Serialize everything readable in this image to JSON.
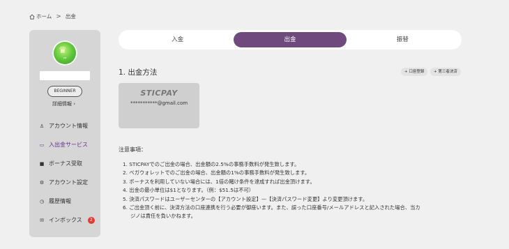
{
  "breadcrumb": {
    "home_label": "ホーム",
    "separator": ">",
    "current": "出金"
  },
  "sidebar": {
    "avatar_text": "VIP",
    "rank": "BEGINNER",
    "details_link": "詳細情報 ›",
    "items": [
      {
        "label": "アカウント情報",
        "icon": "person-icon"
      },
      {
        "label": "入出金サービス",
        "icon": "wallet-icon",
        "active": true
      },
      {
        "label": "ボーナス受取",
        "icon": "gift-icon"
      },
      {
        "label": "アカウント設定",
        "icon": "gear-icon"
      },
      {
        "label": "履歴情報",
        "icon": "history-icon"
      },
      {
        "label": "インボックス",
        "icon": "mail-icon",
        "badge": "2"
      }
    ]
  },
  "tabs": [
    "入金",
    "出金",
    "振替"
  ],
  "active_tab": 1,
  "section": {
    "title": "1. 出金方法",
    "add_account_button": "+ 口座登録",
    "third_party_button": "+ 第三者決済"
  },
  "method_card": {
    "name": "STICPAY",
    "email": "***********@gmail.com"
  },
  "notes": {
    "title": "注意事項：",
    "lines": [
      "1. STICPAYでのご出金の場合、出金額の2.5%の事務手数料が発生致します。",
      "2. ベガウォレットでのご出金の場合、出金額の1%の事務手数料が発生致します。",
      "3. ボーナスを利用していない場合には、1倍の賭け条件を達成すれば出金頂けます。",
      "4. 出金の最小単位は$1となります。（例：$51.5は不可）",
      "5. 決済パスワードはユーザーセンターの【アカウント設定】—【決済パスワード変更】より変更頂けます。",
      "6. ご出金頂く前に、決済方法の口座連携を行う必要が御座います。また、誤った口座番号/メールアドレスと記入された場合、当カ",
      "ジノは責任を負いかねます。"
    ]
  },
  "colors": {
    "accent": "#6e4b7c",
    "active_nav": "#6b2c8f",
    "badge": "#e53935",
    "sidebar_bg": "#d6d6d6",
    "page_bg": "#f0f0f0"
  }
}
